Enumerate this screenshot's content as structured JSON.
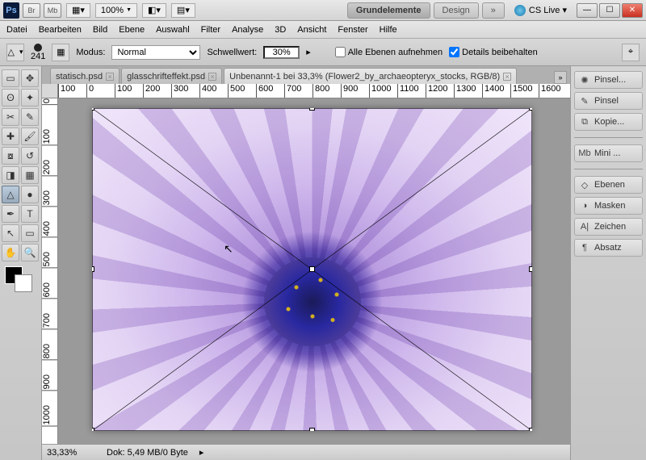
{
  "app": {
    "logo": "Ps",
    "toolbarBtns": [
      "Br",
      "Mb"
    ],
    "film": "▦▾",
    "zoomPct": "100%",
    "viewA": "◧▾",
    "viewB": "▤▾"
  },
  "workspace": {
    "active": "Grundelemente",
    "other": "Design",
    "more": "»",
    "cslive": "CS Live ▾"
  },
  "menus": [
    "Datei",
    "Bearbeiten",
    "Bild",
    "Ebene",
    "Auswahl",
    "Filter",
    "Analyse",
    "3D",
    "Ansicht",
    "Fenster",
    "Hilfe"
  ],
  "options": {
    "brushSize": "241",
    "modusLabel": "Modus:",
    "modusValue": "Normal",
    "threshLabel": "Schwellwert:",
    "threshValue": "30%",
    "chk1": "Alle Ebenen aufnehmen",
    "chk2": "Details beibehalten",
    "chk1Checked": false,
    "chk2Checked": true
  },
  "tabs": [
    {
      "label": "statisch.psd",
      "active": false
    },
    {
      "label": "glasschrifteffekt.psd",
      "active": false
    },
    {
      "label": "Unbenannt-1 bei 33,3% (Flower2_by_archaeopteryx_stocks, RGB/8)",
      "active": true
    }
  ],
  "hruler": [
    "100",
    "0",
    "100",
    "200",
    "300",
    "400",
    "500",
    "600",
    "700",
    "800",
    "900",
    "1000",
    "1100",
    "1200",
    "1300",
    "1400",
    "1500",
    "1600"
  ],
  "vruler": [
    "0",
    "100",
    "200",
    "300",
    "400",
    "500",
    "600",
    "700",
    "800",
    "900",
    "1000"
  ],
  "status": {
    "zoom": "33,33%",
    "dok": "Dok: 5,49 MB/0 Byte"
  },
  "rpanels": [
    {
      "icon": "✺",
      "label": "Pinsel..."
    },
    {
      "icon": "✎",
      "label": "Pinsel"
    },
    {
      "icon": "⧉",
      "label": "Kopie..."
    },
    {
      "divider": true
    },
    {
      "icon": "Mb",
      "label": "Mini ...",
      "mini": true
    },
    {
      "divider": true
    },
    {
      "icon": "◇",
      "label": "Ebenen"
    },
    {
      "icon": "◑",
      "label": "Masken"
    },
    {
      "icon": "A|",
      "label": "Zeichen"
    },
    {
      "icon": "¶",
      "label": "Absatz"
    }
  ],
  "tools": [
    {
      "n": "marquee",
      "g": "▭"
    },
    {
      "n": "move",
      "g": "✥"
    },
    {
      "n": "lasso",
      "g": "ʘ"
    },
    {
      "n": "wand",
      "g": "✦"
    },
    {
      "n": "crop",
      "g": "✂"
    },
    {
      "n": "eyedrop",
      "g": "✎"
    },
    {
      "n": "heal",
      "g": "✚"
    },
    {
      "n": "brush",
      "g": "🖌"
    },
    {
      "n": "stamp",
      "g": "⧇"
    },
    {
      "n": "history",
      "g": "↺"
    },
    {
      "n": "eraser",
      "g": "◨"
    },
    {
      "n": "gradient",
      "g": "▦"
    },
    {
      "n": "blur",
      "g": "△",
      "sel": true
    },
    {
      "n": "dodge",
      "g": "●"
    },
    {
      "n": "pen",
      "g": "✒"
    },
    {
      "n": "type",
      "g": "T"
    },
    {
      "n": "path",
      "g": "↖"
    },
    {
      "n": "shape",
      "g": "▭"
    },
    {
      "n": "hand",
      "g": "✋"
    },
    {
      "n": "zoom",
      "g": "🔍"
    }
  ]
}
